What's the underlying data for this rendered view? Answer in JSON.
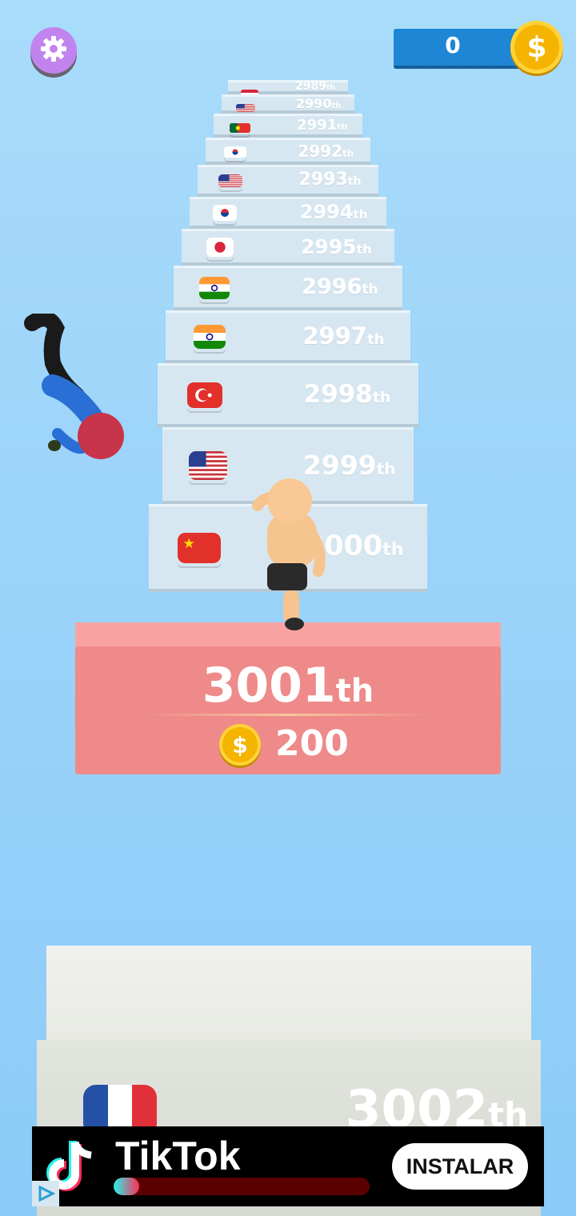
{
  "hud": {
    "settings_icon": "gear-icon",
    "coin_count": "0",
    "coin_symbol": "$"
  },
  "stairs": [
    {
      "rank": "2989",
      "suffix": "th",
      "flag": "unknown"
    },
    {
      "rank": "2990",
      "suffix": "th",
      "flag": "usa"
    },
    {
      "rank": "2991",
      "suffix": "th",
      "flag": "portugal"
    },
    {
      "rank": "2992",
      "suffix": "th",
      "flag": "south-korea"
    },
    {
      "rank": "2993",
      "suffix": "th",
      "flag": "usa"
    },
    {
      "rank": "2994",
      "suffix": "th",
      "flag": "south-korea"
    },
    {
      "rank": "2995",
      "suffix": "th",
      "flag": "japan"
    },
    {
      "rank": "2996",
      "suffix": "th",
      "flag": "india"
    },
    {
      "rank": "2997",
      "suffix": "th",
      "flag": "india"
    },
    {
      "rank": "2998",
      "suffix": "th",
      "flag": "turkey"
    },
    {
      "rank": "2999",
      "suffix": "th",
      "flag": "usa"
    },
    {
      "rank": "3000",
      "suffix": "th",
      "flag": "china"
    }
  ],
  "podium": {
    "rank": "3001",
    "suffix": "th",
    "coin_symbol": "$",
    "reward": "200"
  },
  "foreground_block": {
    "rank": "3002",
    "suffix": "th",
    "flag": "france"
  },
  "ad": {
    "app_name": "TikTok",
    "install_label": "INSTALAR",
    "progress": 0.1,
    "colors": {
      "cyan": "#25f4ee",
      "pink": "#fe2c55"
    }
  }
}
